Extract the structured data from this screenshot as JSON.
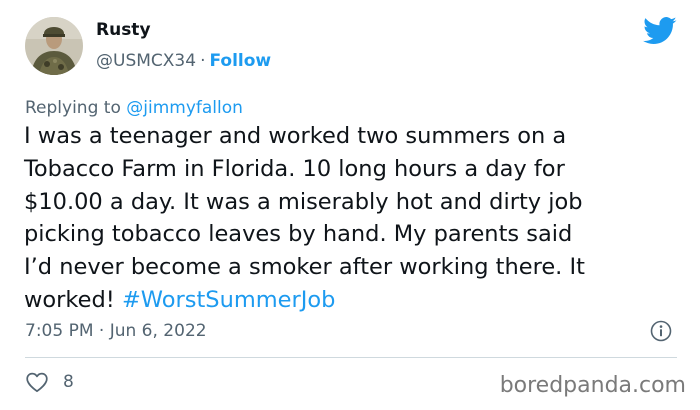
{
  "author": {
    "display_name": "Rusty",
    "handle": "@USMCX34",
    "separator": "·",
    "follow_label": "Follow"
  },
  "reply": {
    "prefix": "Replying to",
    "target": "@jimmyfallon"
  },
  "tweet": {
    "lines": [
      "I was a teenager and worked two summers on a",
      "Tobacco Farm in Florida. 10 long hours a day for",
      "$10.00 a day. It was a miserably hot and dirty job",
      "picking tobacco leaves by hand. My parents said",
      "I’d never become a smoker after working there. It"
    ],
    "last_line_text": "worked!",
    "hashtag": "#WorstSummerJob"
  },
  "meta": {
    "time": "7:05 PM",
    "separator": "·",
    "date": "Jun 6, 2022"
  },
  "engagement": {
    "likes": "8"
  },
  "watermark": "boredpanda.com",
  "icons": {
    "logo": "twitter-bird-icon",
    "info": "info-icon",
    "like": "heart-icon"
  },
  "colors": {
    "accent": "#1d9bf0",
    "text": "#0f1419",
    "muted": "#536471",
    "divider": "#cfd9de",
    "watermark": "#7a7a7a"
  }
}
